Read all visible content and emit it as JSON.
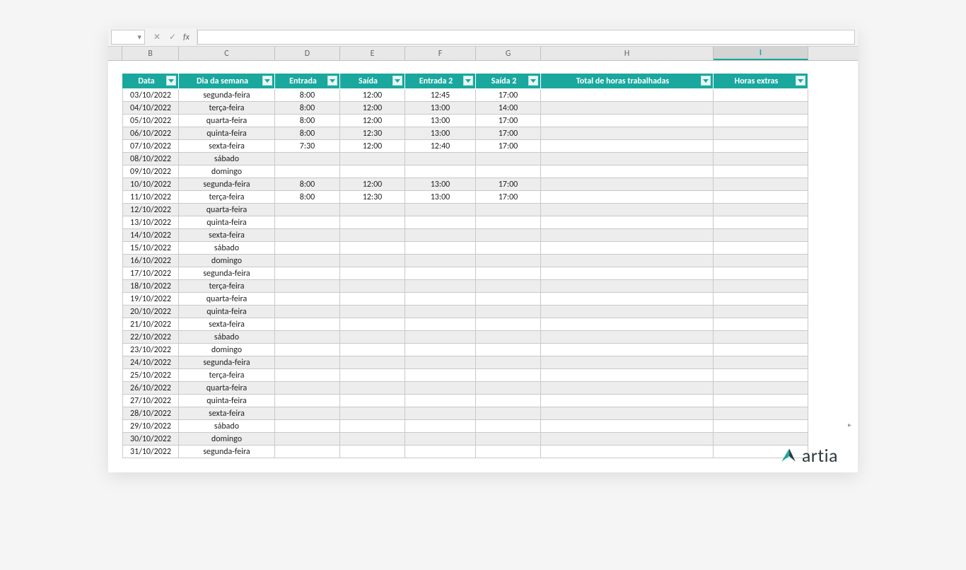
{
  "formula_bar": {
    "name_box": "",
    "fx_label": "fx",
    "formula": ""
  },
  "column_letters": [
    "B",
    "C",
    "D",
    "E",
    "F",
    "G",
    "H",
    "I"
  ],
  "selected_column_index": 7,
  "table": {
    "headers": [
      "Data",
      "Dia da semana",
      "Entrada",
      "Saída",
      "Entrada 2",
      "Saída 2",
      "Total de horas trabalhadas",
      "Horas extras"
    ],
    "rows": [
      {
        "data": "03/10/2022",
        "dia": "segunda-feira",
        "e1": "8:00",
        "s1": "12:00",
        "e2": "12:45",
        "s2": "17:00",
        "total": "",
        "extra": ""
      },
      {
        "data": "04/10/2022",
        "dia": "terça-feira",
        "e1": "8:00",
        "s1": "12:00",
        "e2": "13:00",
        "s2": "14:00",
        "total": "",
        "extra": ""
      },
      {
        "data": "05/10/2022",
        "dia": "quarta-feira",
        "e1": "8:00",
        "s1": "12:00",
        "e2": "13:00",
        "s2": "17:00",
        "total": "",
        "extra": ""
      },
      {
        "data": "06/10/2022",
        "dia": "quinta-feira",
        "e1": "8:00",
        "s1": "12:30",
        "e2": "13:00",
        "s2": "17:00",
        "total": "",
        "extra": ""
      },
      {
        "data": "07/10/2022",
        "dia": "sexta-feira",
        "e1": "7:30",
        "s1": "12:00",
        "e2": "12:40",
        "s2": "17:00",
        "total": "",
        "extra": ""
      },
      {
        "data": "08/10/2022",
        "dia": "sábado",
        "e1": "",
        "s1": "",
        "e2": "",
        "s2": "",
        "total": "",
        "extra": ""
      },
      {
        "data": "09/10/2022",
        "dia": "domingo",
        "e1": "",
        "s1": "",
        "e2": "",
        "s2": "",
        "total": "",
        "extra": ""
      },
      {
        "data": "10/10/2022",
        "dia": "segunda-feira",
        "e1": "8:00",
        "s1": "12:00",
        "e2": "13:00",
        "s2": "17:00",
        "total": "",
        "extra": ""
      },
      {
        "data": "11/10/2022",
        "dia": "terça-feira",
        "e1": "8:00",
        "s1": "12:30",
        "e2": "13:00",
        "s2": "17:00",
        "total": "",
        "extra": ""
      },
      {
        "data": "12/10/2022",
        "dia": "quarta-feira",
        "e1": "",
        "s1": "",
        "e2": "",
        "s2": "",
        "total": "",
        "extra": ""
      },
      {
        "data": "13/10/2022",
        "dia": "quinta-feira",
        "e1": "",
        "s1": "",
        "e2": "",
        "s2": "",
        "total": "",
        "extra": ""
      },
      {
        "data": "14/10/2022",
        "dia": "sexta-feira",
        "e1": "",
        "s1": "",
        "e2": "",
        "s2": "",
        "total": "",
        "extra": ""
      },
      {
        "data": "15/10/2022",
        "dia": "sábado",
        "e1": "",
        "s1": "",
        "e2": "",
        "s2": "",
        "total": "",
        "extra": ""
      },
      {
        "data": "16/10/2022",
        "dia": "domingo",
        "e1": "",
        "s1": "",
        "e2": "",
        "s2": "",
        "total": "",
        "extra": ""
      },
      {
        "data": "17/10/2022",
        "dia": "segunda-feira",
        "e1": "",
        "s1": "",
        "e2": "",
        "s2": "",
        "total": "",
        "extra": ""
      },
      {
        "data": "18/10/2022",
        "dia": "terça-feira",
        "e1": "",
        "s1": "",
        "e2": "",
        "s2": "",
        "total": "",
        "extra": ""
      },
      {
        "data": "19/10/2022",
        "dia": "quarta-feira",
        "e1": "",
        "s1": "",
        "e2": "",
        "s2": "",
        "total": "",
        "extra": ""
      },
      {
        "data": "20/10/2022",
        "dia": "quinta-feira",
        "e1": "",
        "s1": "",
        "e2": "",
        "s2": "",
        "total": "",
        "extra": ""
      },
      {
        "data": "21/10/2022",
        "dia": "sexta-feira",
        "e1": "",
        "s1": "",
        "e2": "",
        "s2": "",
        "total": "",
        "extra": ""
      },
      {
        "data": "22/10/2022",
        "dia": "sábado",
        "e1": "",
        "s1": "",
        "e2": "",
        "s2": "",
        "total": "",
        "extra": ""
      },
      {
        "data": "23/10/2022",
        "dia": "domingo",
        "e1": "",
        "s1": "",
        "e2": "",
        "s2": "",
        "total": "",
        "extra": ""
      },
      {
        "data": "24/10/2022",
        "dia": "segunda-feira",
        "e1": "",
        "s1": "",
        "e2": "",
        "s2": "",
        "total": "",
        "extra": ""
      },
      {
        "data": "25/10/2022",
        "dia": "terça-feira",
        "e1": "",
        "s1": "",
        "e2": "",
        "s2": "",
        "total": "",
        "extra": ""
      },
      {
        "data": "26/10/2022",
        "dia": "quarta-feira",
        "e1": "",
        "s1": "",
        "e2": "",
        "s2": "",
        "total": "",
        "extra": ""
      },
      {
        "data": "27/10/2022",
        "dia": "quinta-feira",
        "e1": "",
        "s1": "",
        "e2": "",
        "s2": "",
        "total": "",
        "extra": ""
      },
      {
        "data": "28/10/2022",
        "dia": "sexta-feira",
        "e1": "",
        "s1": "",
        "e2": "",
        "s2": "",
        "total": "",
        "extra": ""
      },
      {
        "data": "29/10/2022",
        "dia": "sábado",
        "e1": "",
        "s1": "",
        "e2": "",
        "s2": "",
        "total": "",
        "extra": ""
      },
      {
        "data": "30/10/2022",
        "dia": "domingo",
        "e1": "",
        "s1": "",
        "e2": "",
        "s2": "",
        "total": "",
        "extra": ""
      },
      {
        "data": "31/10/2022",
        "dia": "segunda-feira",
        "e1": "",
        "s1": "",
        "e2": "",
        "s2": "",
        "total": "",
        "extra": ""
      }
    ]
  },
  "logo_text": "artia"
}
